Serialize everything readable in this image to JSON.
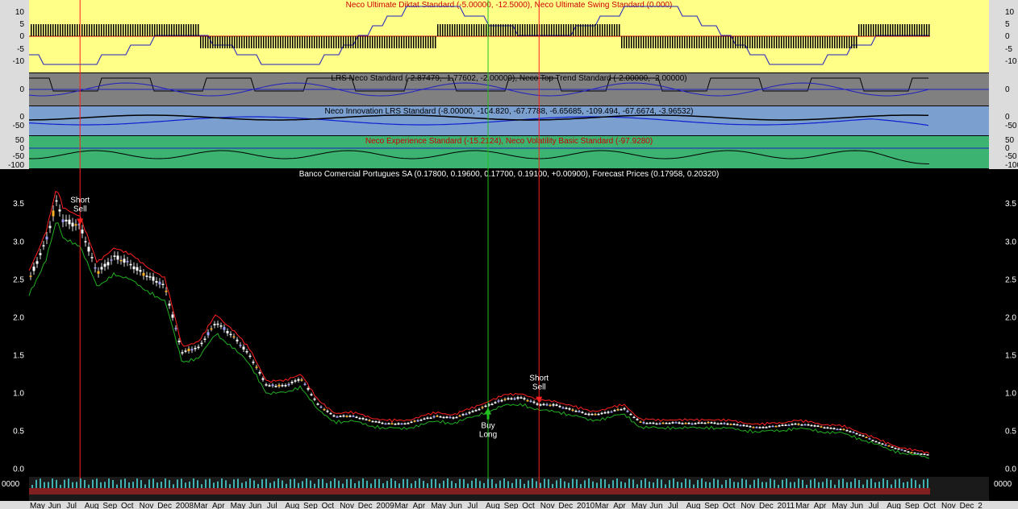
{
  "panels": {
    "p1": {
      "title": "Neco Ultimate Diktat Standard (-5.00000, -12.5000), Neco Ultimate Swing Standard (0.000)",
      "bg": "#ffff88",
      "ticks": [
        "10",
        "5",
        "0",
        "-5",
        "-10"
      ]
    },
    "p2": {
      "title": "LRS Neco Standard (-2.87479, -1.77602, -2.00000), Neco Top Trend Standard (-2.00000, -2.00000)",
      "bg": "#808080",
      "ticks": [
        "0"
      ]
    },
    "p3": {
      "title": "Neco Innovation LRS Standard (-8.00000, -104.820, -67.7788, -6.65685, -109.494, -67.6674, -3.96532)",
      "bg": "#7b9fcf",
      "ticks": [
        "0",
        "-50"
      ]
    },
    "p4": {
      "title": "Neco Experience Standard (-15.2124), Neco Volatility Basic Standard (-97.9280)",
      "bg": "#3cb371",
      "ticks": [
        "50",
        "0",
        "-50",
        "-100"
      ]
    },
    "price": {
      "title": "Banco Comercial Portugues SA (0.17800, 0.19600, 0.17700, 0.19100, +0.00900), Forecast Prices (0.17958, 0.20320)"
    },
    "volume": {
      "left_label": "0000",
      "right_label": "0000"
    }
  },
  "signals": [
    {
      "type": "short",
      "line1": "Short",
      "line2": "Sell",
      "color": "#ff2020"
    },
    {
      "type": "buy",
      "line1": "Buy",
      "line2": "Long",
      "color": "#20c020"
    },
    {
      "type": "short",
      "line1": "Short",
      "line2": "Sell",
      "color": "#ff2020"
    }
  ],
  "time_axis": {
    "labels": [
      "May",
      "Jun",
      "Jul",
      "Aug",
      "Sep",
      "Oct",
      "Nov",
      "Dec",
      "2008",
      "Mar",
      "Apr",
      "May",
      "Jun",
      "Jul",
      "Aug",
      "Sep",
      "Oct",
      "Nov",
      "Dec",
      "2009",
      "Mar",
      "Apr",
      "May",
      "Jun",
      "Jul",
      "Aug",
      "Sep",
      "Oct",
      "Nov",
      "Dec",
      "2010",
      "Mar",
      "Apr",
      "May",
      "Jun",
      "Jul",
      "Aug",
      "Sep",
      "Oct",
      "Nov",
      "Dec",
      "2011",
      "Mar",
      "Apr",
      "May",
      "Jun",
      "Jul",
      "Aug",
      "Sep",
      "Oct",
      "Nov",
      "Dec",
      "2"
    ]
  },
  "chart_data": {
    "type": "line",
    "title": "Banco Comercial Portugues SA (0.17800, 0.19600, 0.17700, 0.19100, +0.00900), Forecast Prices (0.17958, 0.20320)",
    "xlabel": "",
    "ylabel": "",
    "ylim": [
      -0.1,
      3.8
    ],
    "y_ticks": [
      0.0,
      0.5,
      1.0,
      1.5,
      2.0,
      2.5,
      3.0,
      3.5
    ],
    "x_range": [
      "2007-05",
      "2011-10"
    ],
    "series": [
      {
        "values_by_date": [
          [
            "2007-05",
            2.5
          ],
          [
            "2007-06",
            3.0
          ],
          [
            "2007-06-20",
            3.55
          ],
          [
            "2007-07",
            3.3
          ],
          [
            "2007-08",
            3.2
          ],
          [
            "2007-09",
            2.6
          ],
          [
            "2007-10",
            2.8
          ],
          [
            "2007-11",
            2.7
          ],
          [
            "2007-12",
            2.55
          ],
          [
            "2008-01",
            2.4
          ],
          [
            "2008-02",
            1.55
          ],
          [
            "2008-03",
            1.6
          ],
          [
            "2008-04",
            1.95
          ],
          [
            "2008-05",
            1.75
          ],
          [
            "2008-06",
            1.5
          ],
          [
            "2008-07",
            1.1
          ],
          [
            "2008-08",
            1.1
          ],
          [
            "2008-09",
            1.2
          ],
          [
            "2008-10",
            0.85
          ],
          [
            "2008-11",
            0.7
          ],
          [
            "2008-12",
            0.7
          ],
          [
            "2009-01",
            0.65
          ],
          [
            "2009-02",
            0.6
          ],
          [
            "2009-03",
            0.6
          ],
          [
            "2009-04",
            0.65
          ],
          [
            "2009-05",
            0.7
          ],
          [
            "2009-06",
            0.68
          ],
          [
            "2009-07",
            0.75
          ],
          [
            "2009-08",
            0.85
          ],
          [
            "2009-09",
            0.92
          ],
          [
            "2009-10",
            0.95
          ],
          [
            "2009-11",
            0.85
          ],
          [
            "2009-12",
            0.85
          ],
          [
            "2010-01",
            0.78
          ],
          [
            "2010-02",
            0.72
          ],
          [
            "2010-03",
            0.75
          ],
          [
            "2010-04",
            0.8
          ],
          [
            "2010-05",
            0.62
          ],
          [
            "2010-06",
            0.6
          ],
          [
            "2010-07",
            0.62
          ],
          [
            "2010-08",
            0.6
          ],
          [
            "2010-09",
            0.62
          ],
          [
            "2010-10",
            0.6
          ],
          [
            "2010-11",
            0.58
          ],
          [
            "2010-12",
            0.55
          ],
          [
            "2011-01",
            0.57
          ],
          [
            "2011-02",
            0.6
          ],
          [
            "2011-03",
            0.58
          ],
          [
            "2011-04",
            0.55
          ],
          [
            "2011-05",
            0.52
          ],
          [
            "2011-06",
            0.45
          ],
          [
            "2011-07",
            0.35
          ],
          [
            "2011-08",
            0.28
          ],
          [
            "2011-09",
            0.22
          ],
          [
            "2011-10",
            0.19
          ]
        ]
      }
    ],
    "signals": [
      {
        "date": "2007-08",
        "price": 3.2,
        "label": "Short Sell"
      },
      {
        "date": "2009-08",
        "price": 0.85,
        "label": "Buy Long"
      },
      {
        "date": "2009-11",
        "price": 0.85,
        "label": "Short Sell"
      }
    ],
    "colors": {
      "up_band": "#ff2020",
      "down_band": "#20b020",
      "candle": "#ffffff",
      "signal_short": "#ff2020",
      "signal_buy": "#20c020"
    }
  }
}
